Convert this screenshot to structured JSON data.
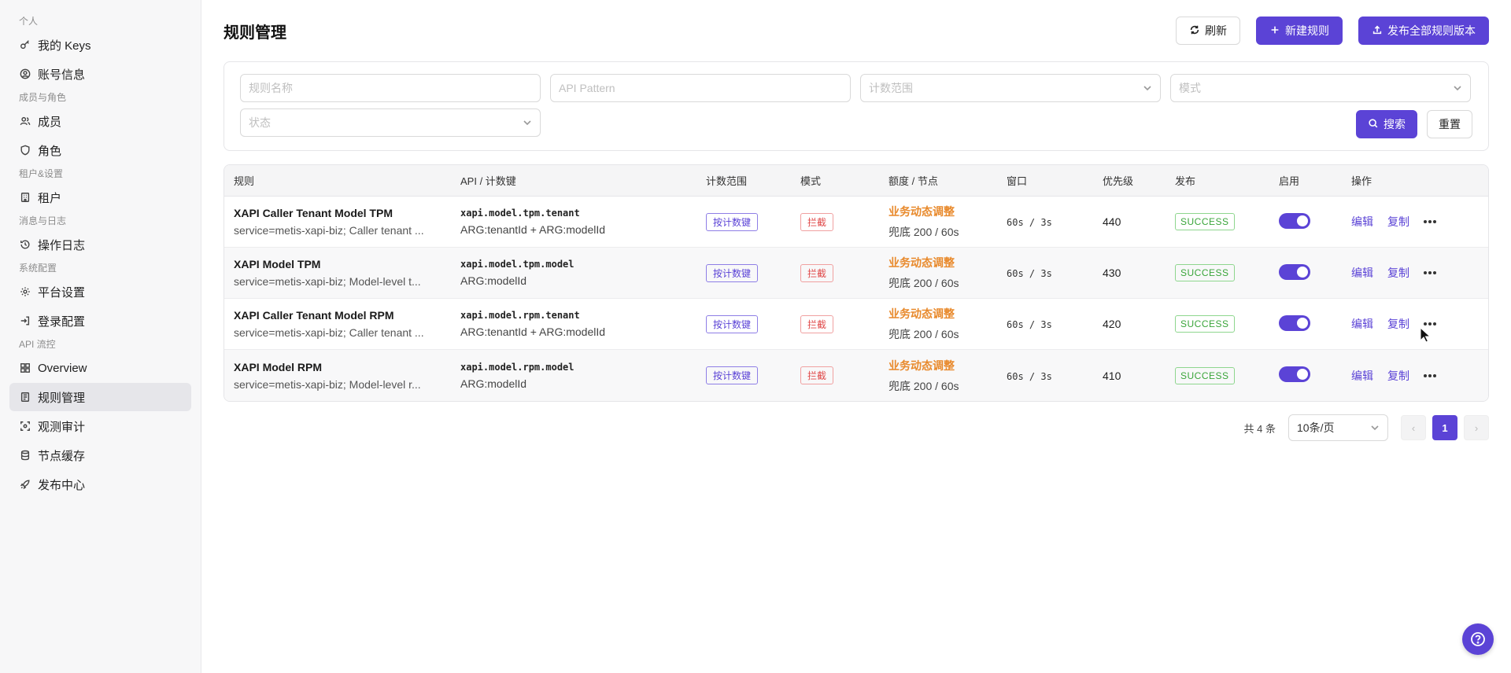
{
  "sidebar": {
    "groups": [
      {
        "label": "个人",
        "items": [
          {
            "label": "我的 Keys",
            "icon": "key-icon"
          },
          {
            "label": "账号信息",
            "icon": "user-circle-icon"
          }
        ]
      },
      {
        "label": "成员与角色",
        "items": [
          {
            "label": "成员",
            "icon": "users-icon"
          },
          {
            "label": "角色",
            "icon": "shield-icon"
          }
        ]
      },
      {
        "label": "租户&设置",
        "items": [
          {
            "label": "租户",
            "icon": "building-icon"
          }
        ]
      },
      {
        "label": "消息与日志",
        "items": [
          {
            "label": "操作日志",
            "icon": "history-icon"
          }
        ]
      },
      {
        "label": "系统配置",
        "items": [
          {
            "label": "平台设置",
            "icon": "gear-icon"
          },
          {
            "label": "登录配置",
            "icon": "login-icon"
          }
        ]
      },
      {
        "label": "API 流控",
        "items": [
          {
            "label": "Overview",
            "icon": "dashboard-icon"
          },
          {
            "label": "规则管理",
            "icon": "rules-icon",
            "active": true
          },
          {
            "label": "观测审计",
            "icon": "scan-icon"
          },
          {
            "label": "节点缓存",
            "icon": "database-icon"
          },
          {
            "label": "发布中心",
            "icon": "rocket-icon"
          }
        ]
      }
    ]
  },
  "header": {
    "title": "规则管理",
    "refresh_label": "刷新",
    "new_rule_label": "新建规则",
    "publish_all_label": "发布全部规则版本"
  },
  "filters": {
    "rule_name_placeholder": "规则名称",
    "api_pattern_placeholder": "API Pattern",
    "scope_placeholder": "计数范围",
    "mode_placeholder": "模式",
    "status_placeholder": "状态",
    "search_label": "搜索",
    "reset_label": "重置"
  },
  "table": {
    "columns": {
      "rule": "规则",
      "api": "API / 计数键",
      "scope": "计数范围",
      "mode": "模式",
      "quota": "额度 / 节点",
      "window": "窗口",
      "priority": "优先级",
      "publish": "发布",
      "enabled": "启用",
      "actions": "操作"
    },
    "rows": [
      {
        "name": "XAPI Caller Tenant Model TPM",
        "desc": "service=metis-xapi-biz; Caller tenant ...",
        "api_key": "xapi.model.tpm.tenant",
        "api_args": "ARG:tenantId + ARG:modelId",
        "scope": "按计数键",
        "mode": "拦截",
        "quota_title": "业务动态调整",
        "quota_sub": "兜底 200 / 60s",
        "window": "60s / 3s",
        "priority": "440",
        "publish": "SUCCESS",
        "enabled": true,
        "edit": "编辑",
        "copy": "复制"
      },
      {
        "name": "XAPI Model TPM",
        "desc": "service=metis-xapi-biz; Model-level t...",
        "api_key": "xapi.model.tpm.model",
        "api_args": "ARG:modelId",
        "scope": "按计数键",
        "mode": "拦截",
        "quota_title": "业务动态调整",
        "quota_sub": "兜底 200 / 60s",
        "window": "60s / 3s",
        "priority": "430",
        "publish": "SUCCESS",
        "enabled": true,
        "edit": "编辑",
        "copy": "复制"
      },
      {
        "name": "XAPI Caller Tenant Model RPM",
        "desc": "service=metis-xapi-biz; Caller tenant ...",
        "api_key": "xapi.model.rpm.tenant",
        "api_args": "ARG:tenantId + ARG:modelId",
        "scope": "按计数键",
        "mode": "拦截",
        "quota_title": "业务动态调整",
        "quota_sub": "兜底 200 / 60s",
        "window": "60s / 3s",
        "priority": "420",
        "publish": "SUCCESS",
        "enabled": true,
        "edit": "编辑",
        "copy": "复制"
      },
      {
        "name": "XAPI Model RPM",
        "desc": "service=metis-xapi-biz; Model-level r...",
        "api_key": "xapi.model.rpm.model",
        "api_args": "ARG:modelId",
        "scope": "按计数键",
        "mode": "拦截",
        "quota_title": "业务动态调整",
        "quota_sub": "兜底 200 / 60s",
        "window": "60s / 3s",
        "priority": "410",
        "publish": "SUCCESS",
        "enabled": true,
        "edit": "编辑",
        "copy": "复制"
      }
    ]
  },
  "pagination": {
    "total_text": "共 4 条",
    "page_size": "10条/页",
    "current_page": "1"
  },
  "colors": {
    "accent": "#5b43d6",
    "warning": "#e8892b",
    "success": "#3aa53a",
    "danger": "#e04a4a"
  }
}
